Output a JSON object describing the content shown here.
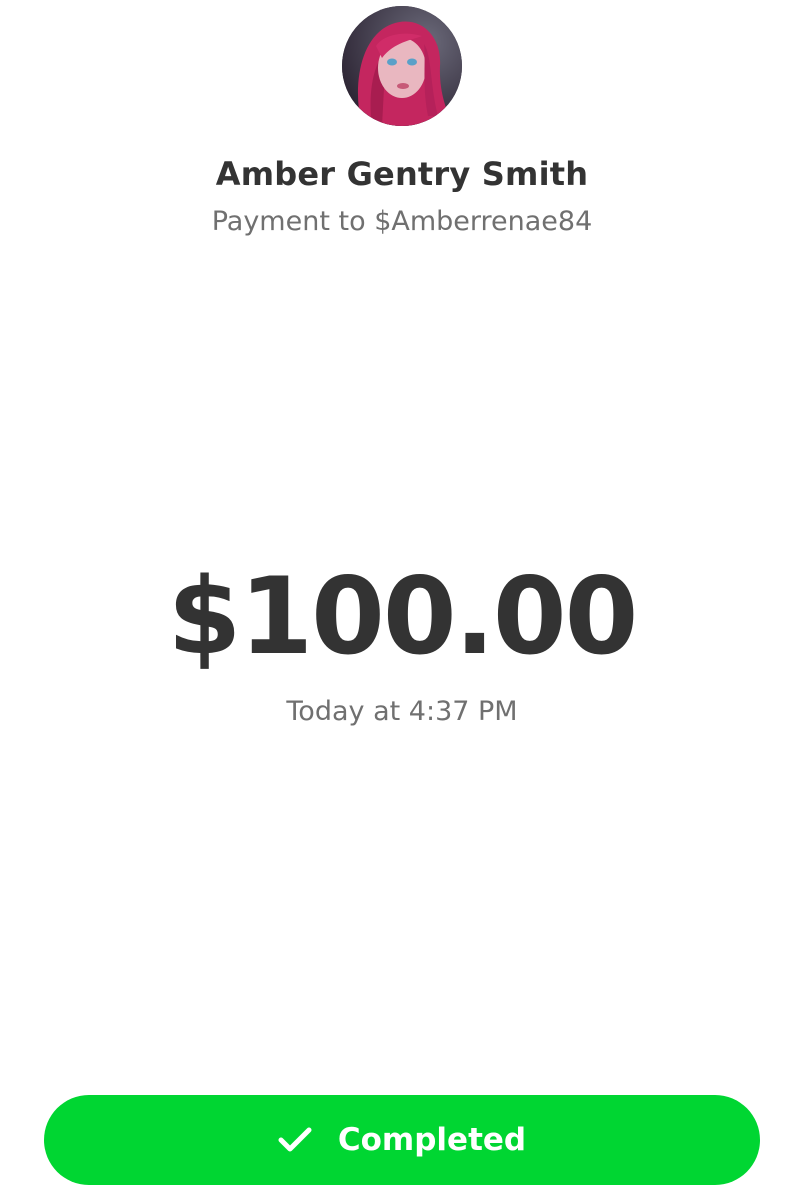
{
  "recipient": {
    "name": "Amber Gentry Smith",
    "payment_line": "Payment to $Amberrenae84"
  },
  "amount": "$100.00",
  "timestamp": "Today at 4:37 PM",
  "status": {
    "label": "Completed",
    "icon": "checkmark-icon",
    "color": "#00d632"
  },
  "colors": {
    "primary_text": "#333333",
    "secondary_text": "#707070",
    "background": "#ffffff"
  }
}
